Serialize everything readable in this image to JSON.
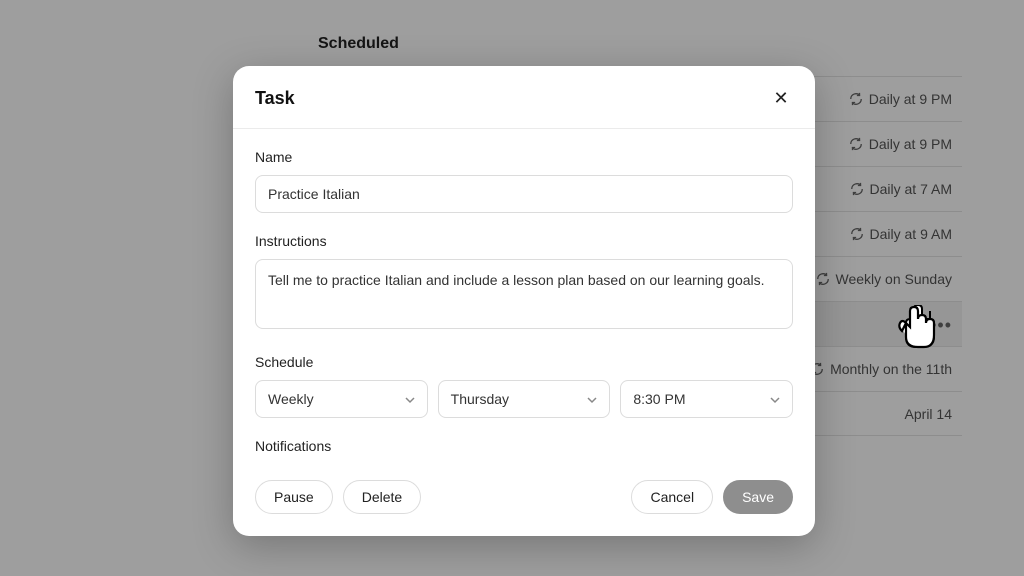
{
  "background": {
    "title": "Scheduled",
    "items": [
      {
        "label": "Daily at 9 PM",
        "icon": "refresh"
      },
      {
        "label": "Daily at 9 PM",
        "icon": "refresh"
      },
      {
        "label": "Daily at 7 AM",
        "icon": "refresh"
      },
      {
        "label": "Daily at 9 AM",
        "icon": "refresh"
      },
      {
        "label": "Weekly on Sunday",
        "icon": "refresh"
      },
      {
        "label": "",
        "icon": "ellipsis",
        "highlight": true
      },
      {
        "label": "Monthly on the 11th",
        "icon": "refresh"
      },
      {
        "label": "April 14",
        "icon": ""
      }
    ]
  },
  "modal": {
    "title": "Task",
    "nameLabel": "Name",
    "nameValue": "Practice Italian",
    "instructionsLabel": "Instructions",
    "instructionsValue": "Tell me to practice Italian and include a lesson plan based on our learning goals.",
    "scheduleLabel": "Schedule",
    "frequencyValue": "Weekly",
    "dayValue": "Thursday",
    "timeValue": "8:30 PM",
    "notificationsLabel": "Notifications",
    "buttons": {
      "pause": "Pause",
      "delete": "Delete",
      "cancel": "Cancel",
      "save": "Save"
    }
  }
}
